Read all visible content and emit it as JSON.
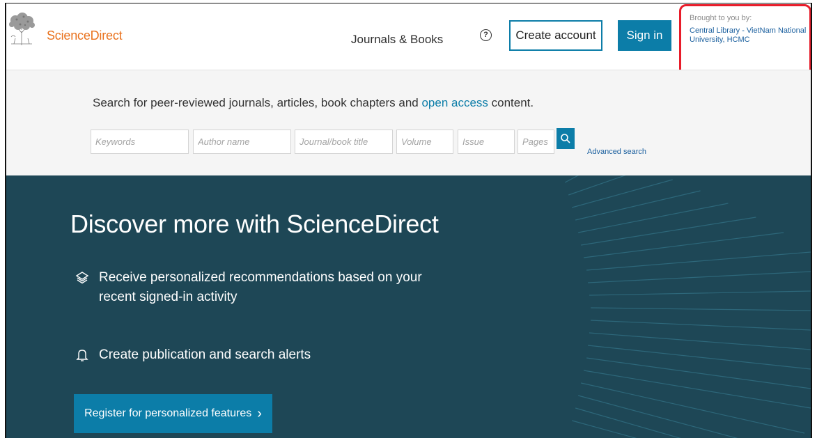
{
  "header": {
    "brand": "ScienceDirect",
    "nav_journals": "Journals & Books",
    "help_symbol": "?",
    "create_account": "Create account",
    "sign_in": "Sign in",
    "brought_label": "Brought to you by:",
    "brought_org": "Central Library - VietNam National University, HCMC"
  },
  "search": {
    "prompt_before": "Search for peer-reviewed journals, articles, book chapters and ",
    "prompt_link": "open access",
    "prompt_after": " content.",
    "fields": {
      "keywords": "Keywords",
      "author": "Author name",
      "journal": "Journal/book title",
      "volume": "Volume",
      "issue": "Issue",
      "pages": "Pages"
    },
    "advanced": "Advanced search"
  },
  "hero": {
    "title": "Discover more with ScienceDirect",
    "feature1": "Receive personalized recommendations based on your recent signed-in activity",
    "feature2": "Create publication and search alerts",
    "register": "Register for personalized features",
    "register_chevron": "›"
  },
  "colors": {
    "brand_orange": "#e9711c",
    "accent_blue": "#0c7da8",
    "hero_bg": "#1e4756",
    "highlight_red": "#e81c2a"
  },
  "icons": [
    "elsevier-tree-logo",
    "help-icon",
    "search-icon",
    "layers-icon",
    "bell-icon",
    "chevron-right-icon"
  ]
}
